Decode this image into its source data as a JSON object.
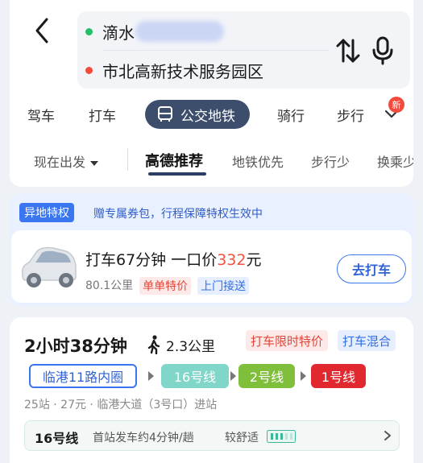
{
  "route": {
    "start": "滴水",
    "end": "市北高新技术服务园区"
  },
  "modes": {
    "drive": "驾车",
    "taxi": "打车",
    "transit": "公交地铁",
    "ride": "骑行",
    "walk": "步行",
    "new_badge": "新"
  },
  "prefs": {
    "depart": "现在出发",
    "recommend": "高德推荐",
    "subway_first": "地铁优先",
    "less_walk": "步行少",
    "less_transfer": "换乘少"
  },
  "promo": {
    "tag": "异地特权",
    "text": "赠专属券包，行程保障特权生效中",
    "taxi_title_prefix": "打车67分钟 一口价",
    "taxi_price": "332",
    "taxi_price_unit": "元",
    "distance": "80.1公里",
    "tag_special": "单单特价",
    "tag_pickup": "上门接送",
    "button": "去打车"
  },
  "plan": {
    "duration": "2小时38分钟",
    "walk": "2.3公里",
    "tag_limited": "打车限时特价",
    "tag_mix": "打车混合",
    "lines": [
      "临港11路内圈",
      "16号线",
      "2号线",
      "1号线"
    ],
    "summary": "25站 · 27元 · 临港大道（3号口）进站",
    "line_info": {
      "name": "16号线",
      "frequency": "首站发车约4分钟/趟",
      "comfort": "较舒适"
    }
  },
  "colors": {
    "accent": "#3a76f0",
    "active_tab": "#3d4e6d",
    "line16": "#7fd6c9",
    "line2": "#7fbf3c",
    "line1": "#e1282f",
    "price": "#f2533e"
  }
}
